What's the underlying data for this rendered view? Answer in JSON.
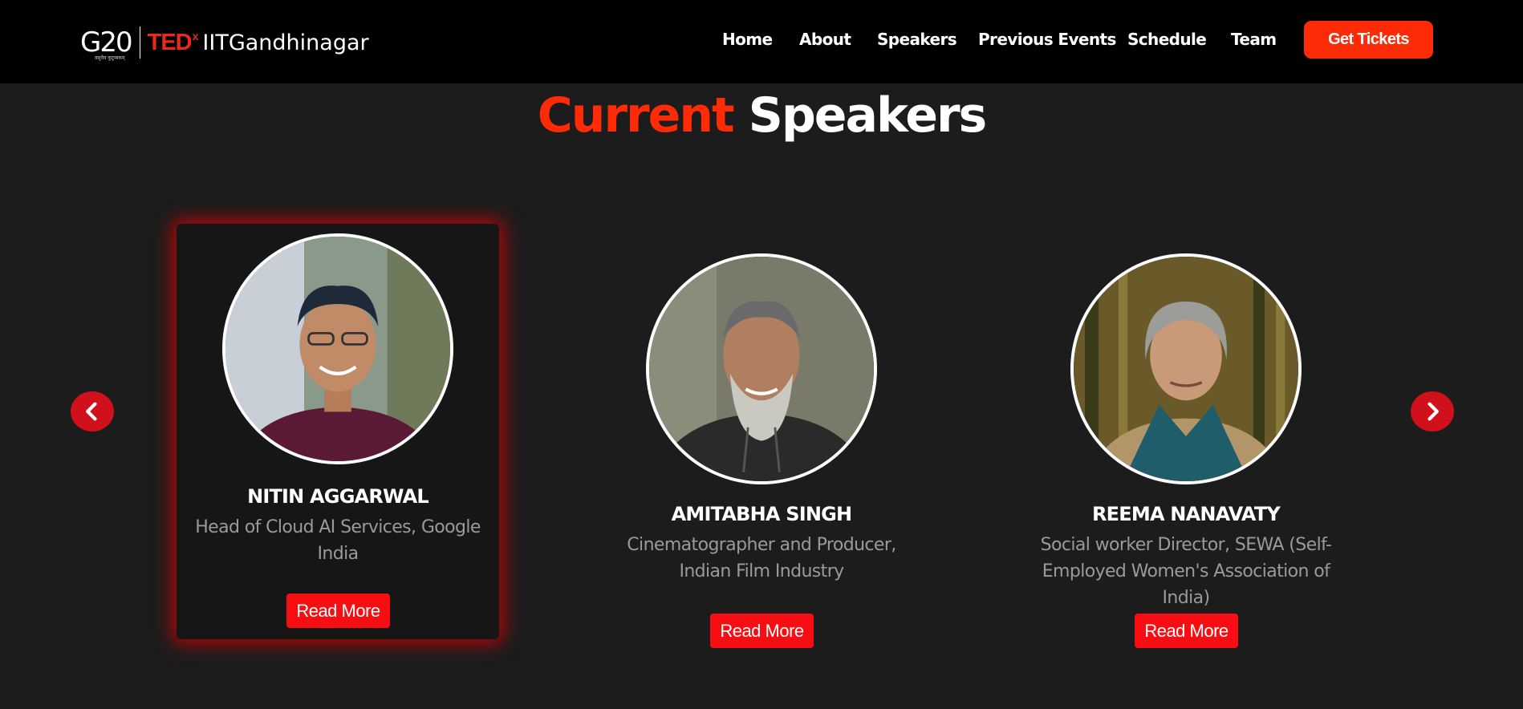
{
  "brand": {
    "g20_text": "G20",
    "g20_sub": "वसुधैव कुटुम्बकम्",
    "ted_text": "TED",
    "ted_x": "x",
    "event_name": "IITGandhinagar"
  },
  "nav": {
    "items": [
      {
        "label": "Home"
      },
      {
        "label": "About"
      },
      {
        "label": "Speakers"
      },
      {
        "label": "Previous Events"
      },
      {
        "label": "Schedule"
      },
      {
        "label": "Team"
      }
    ],
    "cta_label": "Get Tickets"
  },
  "section": {
    "title_accent": "Current",
    "title_rest": "Speakers"
  },
  "carousel": {
    "prev_icon": "chevron-left-icon",
    "next_icon": "chevron-right-icon"
  },
  "speakers": [
    {
      "name": "NITIN AGGARWAL",
      "role_line1": "Head of Cloud AI Services, Google",
      "role_line2": "India",
      "role_line3": "",
      "button": "Read More",
      "active": true
    },
    {
      "name": "AMITABHA SINGH",
      "role_line1": "Cinematographer and Producer,",
      "role_line2": "Indian Film Industry",
      "role_line3": "",
      "button": "Read More",
      "active": false
    },
    {
      "name": "REEMA NANAVATY",
      "role_line1": "Social worker Director, SEWA (Self-",
      "role_line2": "Employed Women's Association of",
      "role_line3": "India)",
      "button": "Read More",
      "active": false
    }
  ],
  "colors": {
    "accent": "#ff2b06",
    "button_red": "#f70d12",
    "arrow_red": "#d0101a",
    "background": "#1c1c1c",
    "nav_bg": "#000000"
  }
}
